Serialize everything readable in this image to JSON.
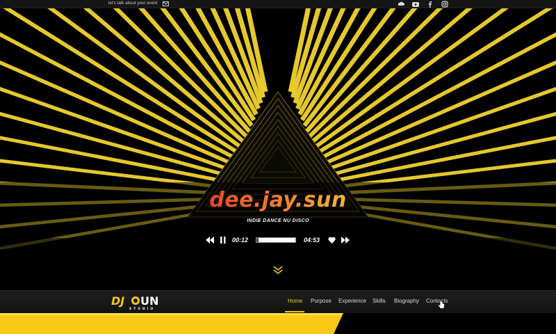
{
  "topbar": {
    "talk_text": "let's talk about your event",
    "icons": [
      "mail-icon",
      "soundcloud-icon",
      "youtube-icon",
      "facebook-icon",
      "instagram-icon"
    ]
  },
  "hero": {
    "brand": "dee.jay.sun",
    "tagline": "INDIE DANCE NU DISCO",
    "player": {
      "elapsed": "00:12",
      "duration": "04:53",
      "progress": 0.05
    }
  },
  "logo": {
    "text": "DJ SUN",
    "subtext": "STUDIO"
  },
  "nav": {
    "items": [
      "Home",
      "Purpose",
      "Experience",
      "Skills",
      "Biography",
      "Contacts"
    ],
    "active": "Home"
  },
  "colors": {
    "accent": "#f5c518",
    "brand_gradient_start": "#e8452c",
    "brand_gradient_end": "#f2b33a",
    "background": "#000000"
  }
}
